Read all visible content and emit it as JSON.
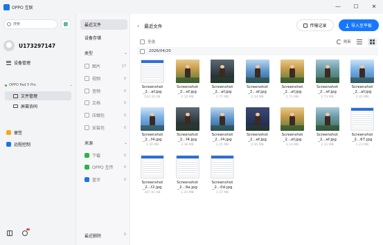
{
  "window": {
    "app_title": "OPPO 互联",
    "min": "—",
    "max": "☐",
    "close": "✕"
  },
  "sidebar": {
    "search_placeholder": "搜索",
    "username": "U173297147",
    "device_manage": "设备管理",
    "device_name": "OPPO Pad 5 Pro",
    "file_manage": "文件管理",
    "screen_collab": "屏幕协同",
    "notes": "便签",
    "remote_control": "远程控制"
  },
  "middle": {
    "recent_files": "最近文件",
    "device_storage": "设备存储",
    "type_header": "类型",
    "categories": [
      {
        "label": "图片",
        "count": "17"
      },
      {
        "label": "视频",
        "count": "0"
      },
      {
        "label": "音频",
        "count": "0"
      },
      {
        "label": "文档",
        "count": "0"
      },
      {
        "label": "压缩包",
        "count": "0"
      },
      {
        "label": "安装包",
        "count": "0"
      }
    ],
    "source_header": "来源",
    "sources": [
      {
        "label": "下载",
        "count": "0",
        "color": "#2fb344"
      },
      {
        "label": "OPPO 互传",
        "count": "0",
        "color": "#2fb344"
      },
      {
        "label": "蓝牙",
        "count": "0",
        "color": "#1a73e8"
      }
    ],
    "recently_deleted": "最近删除",
    "deleted_count": "0"
  },
  "content": {
    "title": "最近文件",
    "transfer_history": "传输记录",
    "import_button": "导入至平板",
    "select_all": "全选",
    "refresh": "刷新",
    "date": "2026/04/20",
    "files": [
      {
        "name1": "Screenshot",
        "name2": "_2...af.jpg",
        "size": "542.20 KB",
        "thumb": "gui"
      },
      {
        "name1": "Screenshot",
        "name2": "_2...ef.jpg",
        "size": "2.10 MB",
        "thumb": "gyel"
      },
      {
        "name1": "Screenshot",
        "name2": "_2...af.jpg",
        "size": "1.77 MB",
        "thumb": "gdark"
      },
      {
        "name1": "Screenshot",
        "name2": "_2...af.jpg",
        "size": "2.34 MB",
        "thumb": "g2"
      },
      {
        "name1": "Screenshot",
        "name2": "_2...af.jpg",
        "size": "2.71 MB",
        "thumb": "gyel"
      },
      {
        "name1": "Screenshot",
        "name2": "_2...ef.jpg",
        "size": "2.73 MB",
        "thumb": "ggreen"
      },
      {
        "name1": "Screenshot",
        "name2": "_2...af.jpg",
        "size": "2.42 MB",
        "thumb": "g1"
      },
      {
        "name1": "Screenshot",
        "name2": "_2...f4.jpg",
        "size": "3.30 MB",
        "thumb": "g1"
      },
      {
        "name1": "Screenshot",
        "name2": "_2...f4.jpg",
        "size": "3.38 MB",
        "thumb": "gdark"
      },
      {
        "name1": "Screenshot",
        "name2": "_2...f4.jpg",
        "size": "3.45 MB",
        "thumb": "g2"
      },
      {
        "name1": "Screenshot",
        "name2": "_2...ef.jpg",
        "size": "2.95 MB",
        "thumb": "gnight"
      },
      {
        "name1": "Screenshot",
        "name2": "_2...ef.jpg",
        "size": "3.14 MB",
        "thumb": "gyel"
      },
      {
        "name1": "Screenshot",
        "name2": "_2...ef.jpg",
        "size": "2.31 MB",
        "thumb": "ggreen"
      },
      {
        "name1": "Screenshot",
        "name2": "_2...67.jpg",
        "size": "1.23 MB",
        "thumb": "gui"
      },
      {
        "name1": "Screenshot",
        "name2": "_2...f2.jpg",
        "size": "307.97 KB",
        "thumb": "gui"
      },
      {
        "name1": "Screenshot",
        "name2": "_2...9a.jpg",
        "size": "1.20 MB",
        "thumb": "gui"
      },
      {
        "name1": "Screenshot",
        "name2": "_2...0d.jpg",
        "size": "1.37 MB",
        "thumb": "gui"
      }
    ]
  }
}
